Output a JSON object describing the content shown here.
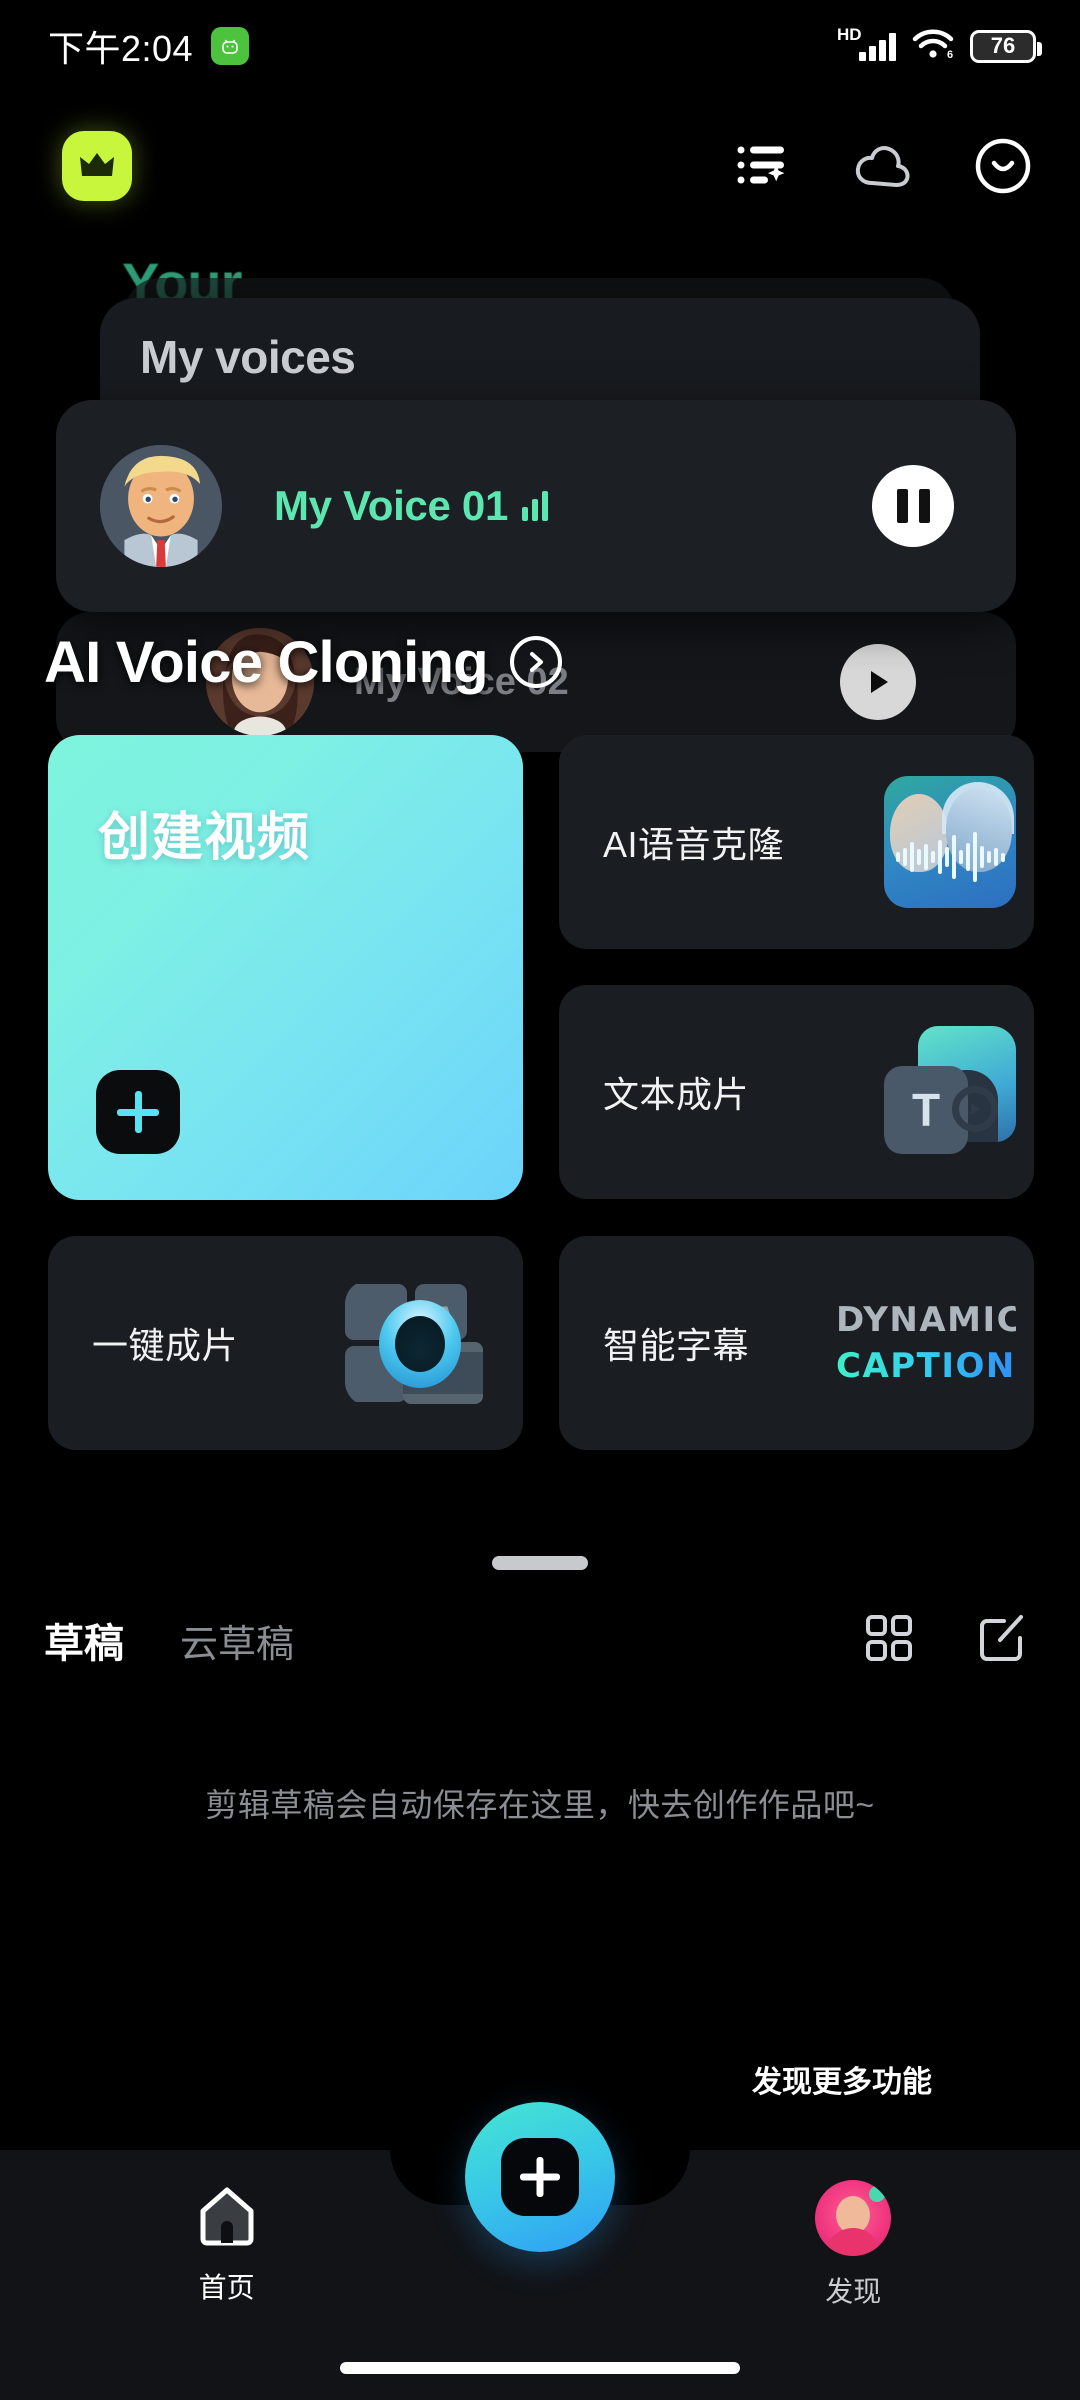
{
  "status_bar": {
    "time": "下午2:04",
    "app_badge_icon": "android-robot-icon",
    "network_type": "HD",
    "wifi_generation": "6",
    "battery_percent": "76",
    "signal_icon": "signal-bars-icon",
    "wifi_icon": "wifi-icon",
    "battery_icon": "battery-icon"
  },
  "app_bar": {
    "vip_badge_icon": "crown-icon",
    "actions": [
      {
        "name": "ai-list-icon",
        "label": "AI列表"
      },
      {
        "name": "cloud-icon",
        "label": "云空间"
      },
      {
        "name": "profile-smiley-icon",
        "label": "我的"
      }
    ]
  },
  "hero": {
    "background_title": "Your",
    "title": "AI Voice Cloning",
    "arrow_icon": "chevron-right-circle-icon",
    "voices_panel": {
      "title": "My voices",
      "rows": [
        {
          "name": "My Voice 01",
          "name_color": "#5ce7b0",
          "eq_icon": "equalizer-icon",
          "control": "pause",
          "control_icon": "pause-icon",
          "avatar_icon": "avatar-trump"
        },
        {
          "name": "My Voice 02",
          "name_color": "#8d9197",
          "control": "play",
          "control_icon": "play-icon",
          "avatar_icon": "avatar-woman"
        }
      ]
    }
  },
  "features": {
    "create_card": {
      "title": "创建视频",
      "plus_icon": "plus-icon",
      "gradient_from": "#7ef4dd",
      "gradient_to": "#6cd3fa"
    },
    "cards": [
      {
        "label": "AI语音克隆",
        "thumb": "ai-voice-clone-thumb"
      },
      {
        "label": "文本成片",
        "thumb": "text-to-video-thumb"
      },
      {
        "label": "一键成片",
        "thumb": "one-click-edit-thumb"
      },
      {
        "label": "智能字幕",
        "thumb": "dynamic-captions-thumb",
        "thumb_line1": "DYNAMIC",
        "thumb_line2": "CAPTIONS"
      }
    ]
  },
  "drafts": {
    "tabs": [
      {
        "label": "草稿",
        "active": true
      },
      {
        "label": "云草稿",
        "active": false
      }
    ],
    "grid_icon": "grid-view-icon",
    "edit_icon": "edit-pencil-icon",
    "empty_text": "剪辑草稿会自动保存在这里，快去创作作品吧~",
    "more_features_text": "发现更多功能"
  },
  "bottom_nav": {
    "items": [
      {
        "label": "首页",
        "icon": "home-icon",
        "active": true
      },
      {
        "label": "发现",
        "icon": "discover-avatar-icon",
        "active": false
      }
    ],
    "fab": {
      "icon": "plus-icon",
      "gradient_from": "#45e6d2",
      "gradient_to": "#2f9ef5"
    }
  }
}
